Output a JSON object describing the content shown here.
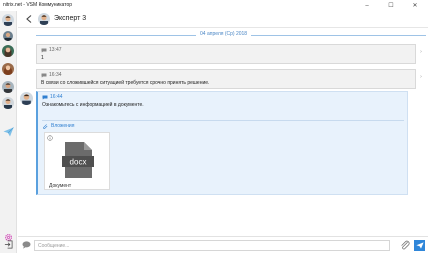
{
  "window": {
    "title": "nitrix.net - VSM Коммуникатор",
    "controls": {
      "minimize": "–",
      "maximize": "☐",
      "close": "✕"
    }
  },
  "header": {
    "contact_name": "Эксперт 3"
  },
  "chat": {
    "date_separator": "04 апреля (Ср) 2018",
    "messages": [
      {
        "time": "13:47",
        "text": "1"
      },
      {
        "time": "16:34",
        "text": "В связи со сложившейся ситуацией требуется срочно принять решение."
      },
      {
        "time": "16:44",
        "text": "Ознакомьтесь с информацией в документе.",
        "attachments_label": "Вложения",
        "attachment": {
          "type_label": "docx",
          "name": "Документ"
        }
      }
    ]
  },
  "composer": {
    "placeholder": "Сообщение..."
  },
  "colors": {
    "accent": "#2f86d9",
    "active_bubble": "#e8f2fc",
    "bubble": "#f2f2f2"
  }
}
